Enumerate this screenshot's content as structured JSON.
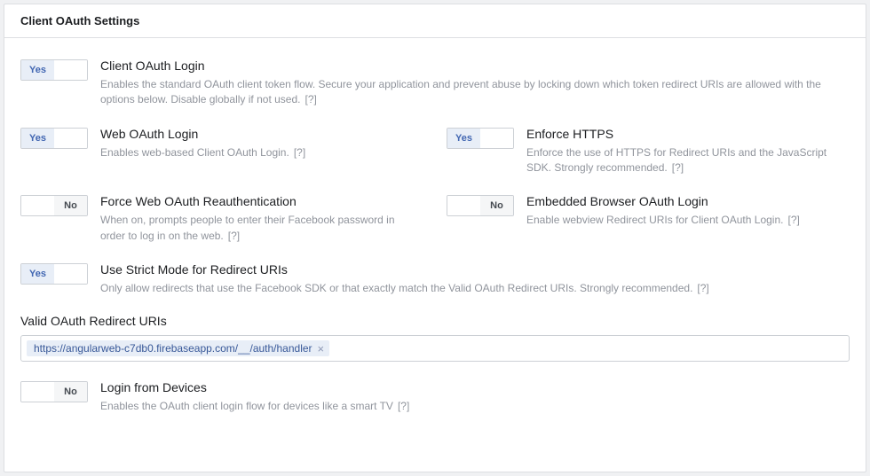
{
  "panel_title": "Client OAuth Settings",
  "toggle_labels": {
    "yes": "Yes",
    "no": "No"
  },
  "help_marker": "[?]",
  "settings": {
    "client_oauth_login": {
      "title": "Client OAuth Login",
      "desc_pre": "Enables the standard OAuth client token flow. Secure your application and prevent abuse by locking down which token redirect URIs are allowed with the options below. Disable globally if not used."
    },
    "web_oauth_login": {
      "title": "Web OAuth Login",
      "desc_pre": "Enables web-based Client OAuth Login."
    },
    "enforce_https": {
      "title": "Enforce HTTPS",
      "desc_pre": "Enforce the use of HTTPS for Redirect URIs and the JavaScript SDK. Strongly recommended."
    },
    "force_reauth": {
      "title": "Force Web OAuth Reauthentication",
      "desc_pre": "When on, prompts people to enter their Facebook password in order to log in on the web."
    },
    "embedded_browser": {
      "title": "Embedded Browser OAuth Login",
      "desc_pre": "Enable webview Redirect URIs for Client OAuth Login."
    },
    "strict_mode": {
      "title": "Use Strict Mode for Redirect URIs",
      "desc_pre": "Only allow redirects that use the Facebook SDK or that exactly match the Valid OAuth Redirect URIs. Strongly recommended."
    },
    "login_devices": {
      "title": "Login from Devices",
      "desc_pre": "Enables the OAuth client login flow for devices like a smart TV"
    }
  },
  "redirect_uris": {
    "label": "Valid OAuth Redirect URIs",
    "tokens": [
      "https://angularweb-c7db0.firebaseapp.com/__/auth/handler"
    ]
  }
}
